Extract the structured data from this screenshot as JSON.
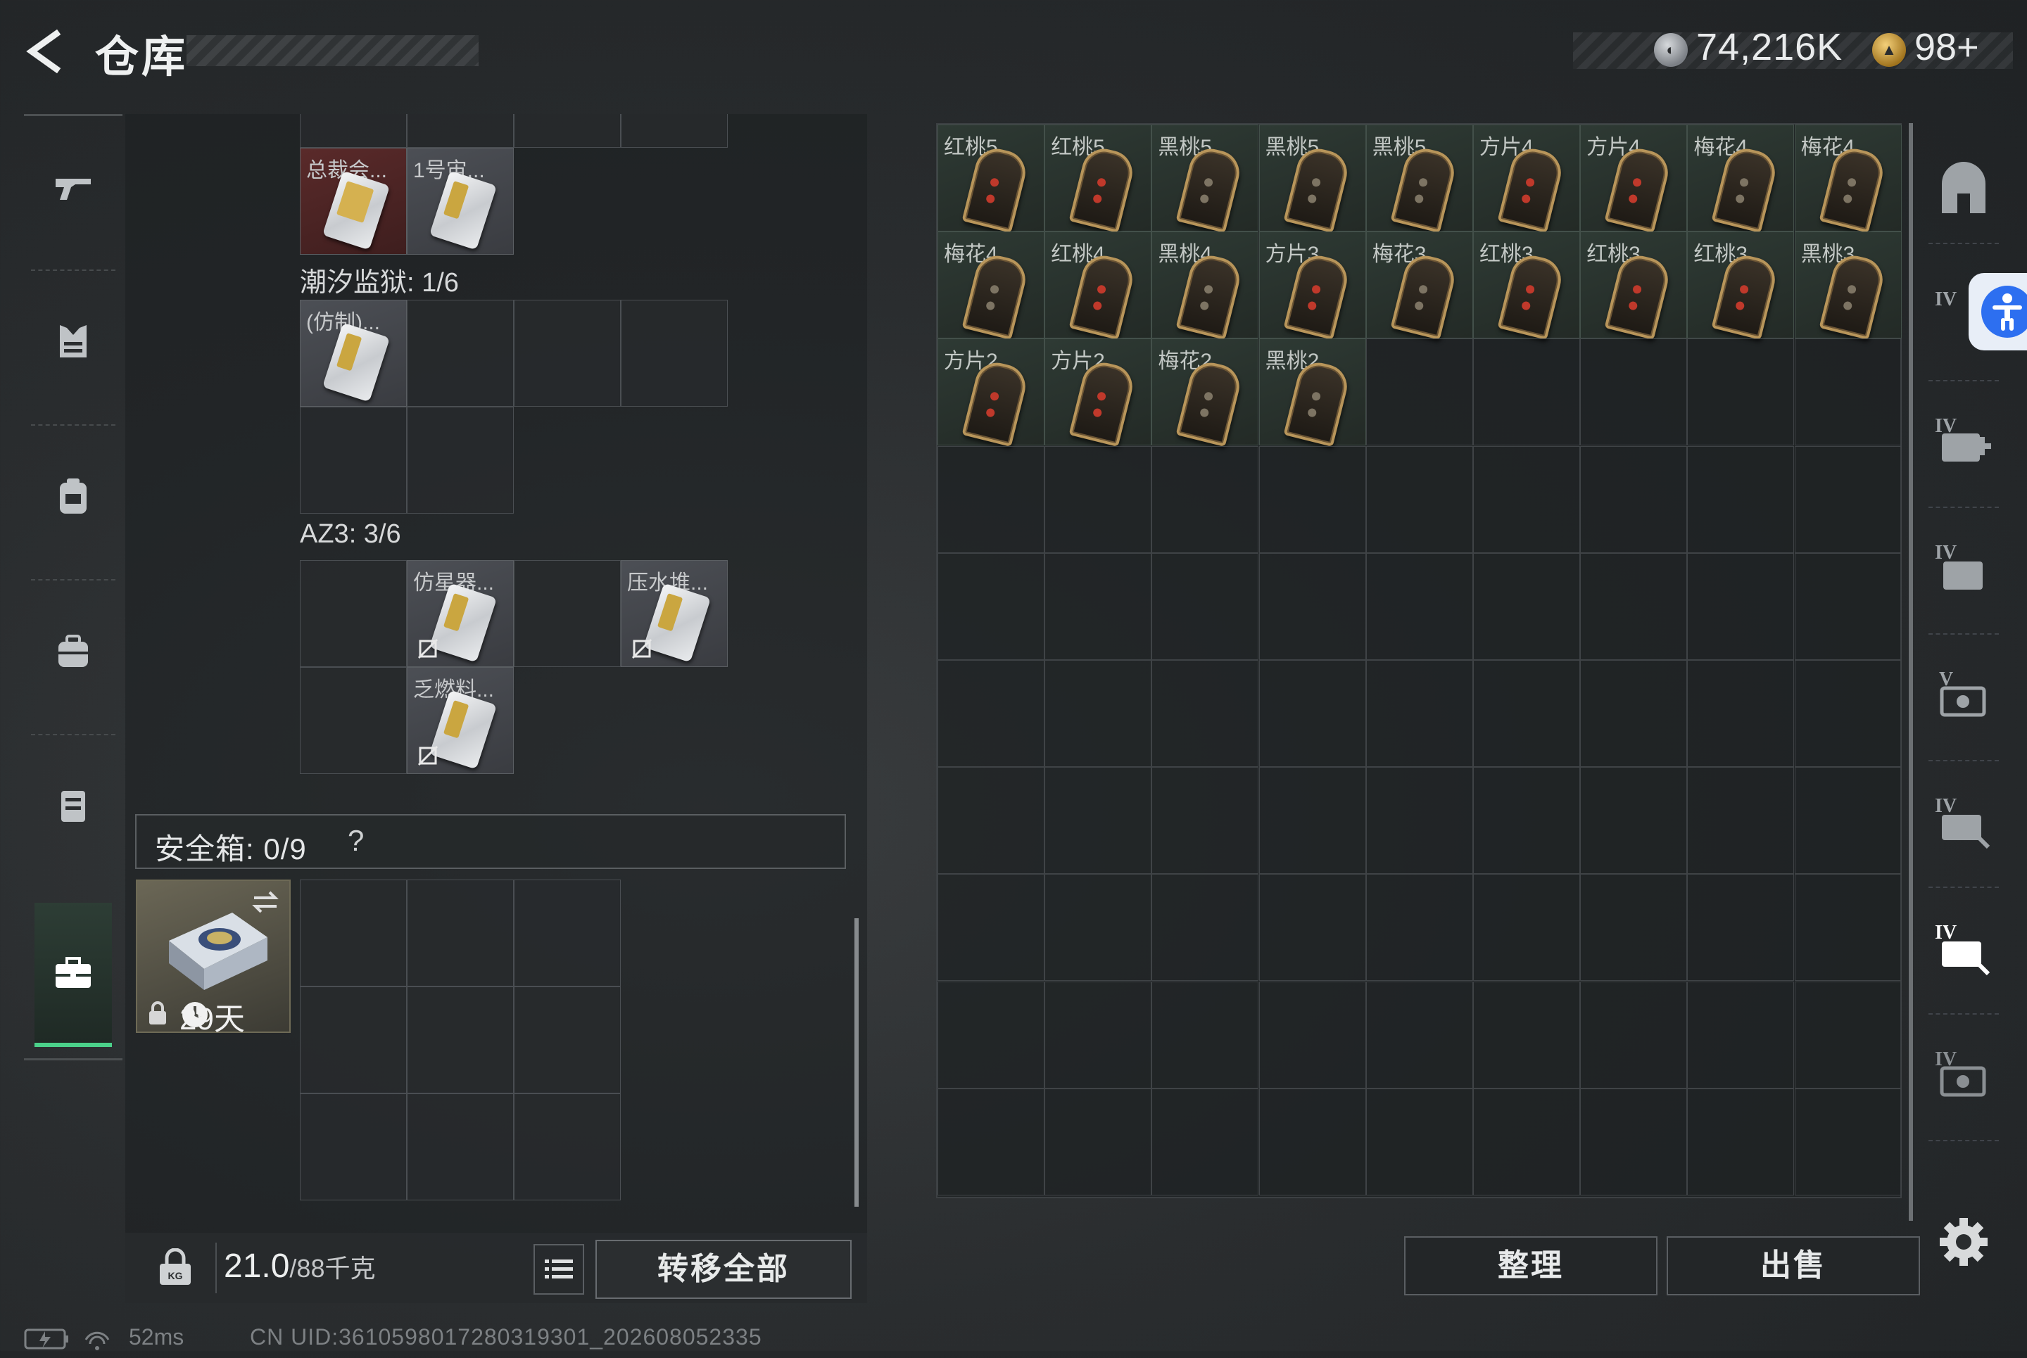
{
  "header": {
    "title": "仓库",
    "money": "74,216K",
    "tickets": "98+"
  },
  "left_nav": {
    "items": [
      "gun-icon",
      "armor-icon",
      "backpack-icon",
      "bag-icon",
      "vest-icon",
      "case-icon"
    ],
    "active": "case-icon"
  },
  "backpack": {
    "top_items": [
      {
        "name": "总裁会...",
        "style": "red"
      },
      {
        "name": "1号宙...",
        "style": "white"
      }
    ],
    "section1": {
      "label": "潮汐监狱: 1/6",
      "items": [
        {
          "name": "(仿制)..."
        }
      ]
    },
    "section2": {
      "label": "AZ3: 3/6",
      "items": [
        {
          "name": "仿星器..."
        },
        {
          "name": "压水堆..."
        },
        {
          "name": "乏燃料..."
        }
      ]
    }
  },
  "safe_box": {
    "label": "安全箱: 0/9",
    "help": "?",
    "days": "29天"
  },
  "footer_left": {
    "weight": "21.0",
    "weight_max": "/88千克",
    "transfer_all": "转移全部"
  },
  "warehouse": {
    "items": [
      {
        "name": "红桃5",
        "suit": "red"
      },
      {
        "name": "红桃5",
        "suit": "red"
      },
      {
        "name": "黑桃5",
        "suit": "dark"
      },
      {
        "name": "黑桃5",
        "suit": "dark"
      },
      {
        "name": "黑桃5",
        "suit": "dark"
      },
      {
        "name": "方片4",
        "suit": "red"
      },
      {
        "name": "方片4",
        "suit": "red"
      },
      {
        "name": "梅花4",
        "suit": "dark"
      },
      {
        "name": "梅花4",
        "suit": "dark"
      },
      {
        "name": "梅花4",
        "suit": "dark"
      },
      {
        "name": "红桃4",
        "suit": "red"
      },
      {
        "name": "黑桃4",
        "suit": "dark"
      },
      {
        "name": "方片3",
        "suit": "red"
      },
      {
        "name": "梅花3",
        "suit": "dark"
      },
      {
        "name": "红桃3",
        "suit": "red"
      },
      {
        "name": "红桃3",
        "suit": "red"
      },
      {
        "name": "红桃3",
        "suit": "red"
      },
      {
        "name": "黑桃3",
        "suit": "dark"
      },
      {
        "name": "方片2",
        "suit": "red"
      },
      {
        "name": "方片2",
        "suit": "red"
      },
      {
        "name": "梅花2",
        "suit": "dark"
      },
      {
        "name": "黑桃2",
        "suit": "dark"
      }
    ],
    "sort_label": "整理",
    "sell_label": "出售"
  },
  "right_tabs": [
    "home-icon",
    "tab-iv-1",
    "tab-iv-add",
    "tab-iv-folder",
    "tab-v-stack",
    "tab-iv-tools",
    "tab-iv-active",
    "tab-iv-last"
  ],
  "status": {
    "ping": "52ms",
    "uid": "CN UID:3610598017280319301_202608052335"
  },
  "colors": {
    "accent_green": "#4bd18a",
    "key_red_pip": "#c0392b",
    "key_dark_pip": "#7d7463"
  }
}
